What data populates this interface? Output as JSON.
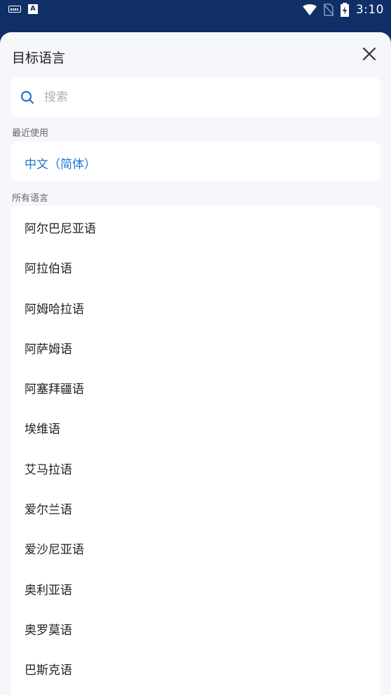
{
  "status_bar": {
    "time": "3:10",
    "left_icons": [
      "keyboard-icon",
      "a-icon"
    ],
    "right_icons": [
      "wifi-icon",
      "no-sim-icon",
      "battery-charging-icon"
    ],
    "a_icon_text": "A"
  },
  "header": {
    "title": "目标语言",
    "close_icon": "close-icon"
  },
  "search": {
    "placeholder": "搜索",
    "value": ""
  },
  "recent": {
    "label": "最近使用",
    "items": [
      "中文（简体）"
    ],
    "accent_color": "#1e73d6"
  },
  "all_languages": {
    "label": "所有语言",
    "items": [
      "阿尔巴尼亚语",
      "阿拉伯语",
      "阿姆哈拉语",
      "阿萨姆语",
      "阿塞拜疆语",
      "埃维语",
      "艾马拉语",
      "爱尔兰语",
      "爱沙尼亚语",
      "奥利亚语",
      "奥罗莫语",
      "巴斯克语"
    ]
  },
  "colors": {
    "status_bar_bg": "#0f2f66",
    "sheet_bg": "#f5f7fa",
    "card_bg": "#ffffff"
  }
}
